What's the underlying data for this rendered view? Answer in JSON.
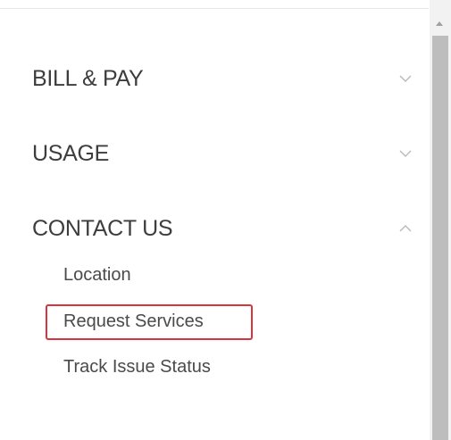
{
  "sidebar": {
    "sections": [
      {
        "title": "BILL & PAY",
        "state": "collapsed",
        "chevron": "chevron-down-icon"
      },
      {
        "title": "USAGE",
        "state": "collapsed",
        "chevron": "chevron-down-icon"
      },
      {
        "title": "CONTACT US",
        "state": "expanded",
        "chevron": "chevron-up-icon"
      }
    ],
    "contact_links": [
      {
        "label": "Location"
      },
      {
        "label": "Request Services",
        "highlighted": true
      },
      {
        "label": "Track Issue Status"
      }
    ]
  },
  "colors": {
    "text": "#3d3d3d",
    "link": "#4a4a4a",
    "chevron": "#b9b9b9",
    "highlight": "#d7343b",
    "scroll_track": "#f2f2f2",
    "scroll_thumb": "#bdbdbd"
  }
}
